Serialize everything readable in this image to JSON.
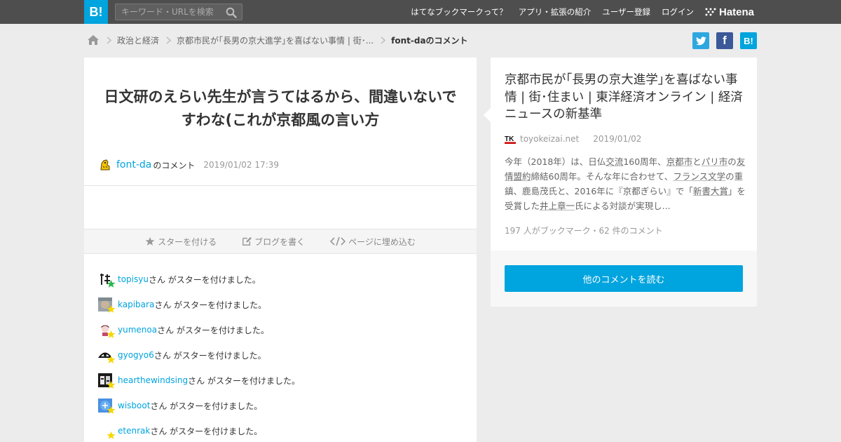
{
  "header": {
    "logo_text": "B!",
    "search_placeholder": "キーワード・URLを検索",
    "nav": [
      "はてなブックマークって？",
      "アプリ・拡張の紹介",
      "ユーザー登録",
      "ログイン"
    ],
    "brand": "Hatena"
  },
  "breadcrumb": {
    "items": [
      "政治と経済",
      "京都市民が｢長男の京大進学｣を喜ばない事情 | 街･..."
    ],
    "current": "font-daのコメント"
  },
  "share": {
    "facebook": "f",
    "hatena": "B!"
  },
  "comment": {
    "text": "日文研のえらい先生が言うてはるから、間違いないですわな(これが京都風の言い方",
    "user": "font-da",
    "user_suffix": "のコメント",
    "date": "2019/01/02 17:39"
  },
  "actions": {
    "star": "スターを付ける",
    "blog": "ブログを書く",
    "embed": "ページに埋め込む"
  },
  "star_suffix": "さん がスターを付けました。",
  "stars": [
    {
      "user": "topisyu",
      "color": "#2db84d"
    },
    {
      "user": "kapibara",
      "color": "#f5d800"
    },
    {
      "user": "yumenoa",
      "color": "#f5d800"
    },
    {
      "user": "gyogyo6",
      "color": "#f5d800"
    },
    {
      "user": "hearthewindsing",
      "color": "#f5d800"
    },
    {
      "user": "wisboot",
      "color": "#f5d800"
    },
    {
      "user": "etenrak",
      "color": "#f5d800"
    }
  ],
  "entry": {
    "title": "京都市民が｢長男の京大進学｣を喜ばない事情 | 街･住まい | 東洋経済オンライン | 経済ニュースの新基準",
    "favicon_text": "TK",
    "site": "toyokeizai.net",
    "date": "2019/01/02",
    "summary": {
      "p1": "今年（2018年）は、日仏",
      "l1": "交流",
      "p2": "160周年、",
      "l2": "京都市",
      "p3": "と",
      "l3": "パリ市",
      "p4": "の",
      "l4": "友情盟約",
      "p5": "締結60周年。そんな年に合わせて、",
      "l5": "フランス文学",
      "p6": "の重鎮、鹿島茂氏と、2016年に『京都ぎらい』で「",
      "l6": "新書大賞",
      "p7": "」を受賞した",
      "l7": "井上章一",
      "p8": "氏による対談が実現し..."
    },
    "bookmark_count": "197 人がブックマーク・62 件のコメント"
  },
  "more_button": "他のコメントを読む",
  "colors": {
    "accent": "#00a4de",
    "topbar": "#4e4e4e",
    "twitter": "#2ea7e0",
    "facebook": "#3b5998"
  }
}
